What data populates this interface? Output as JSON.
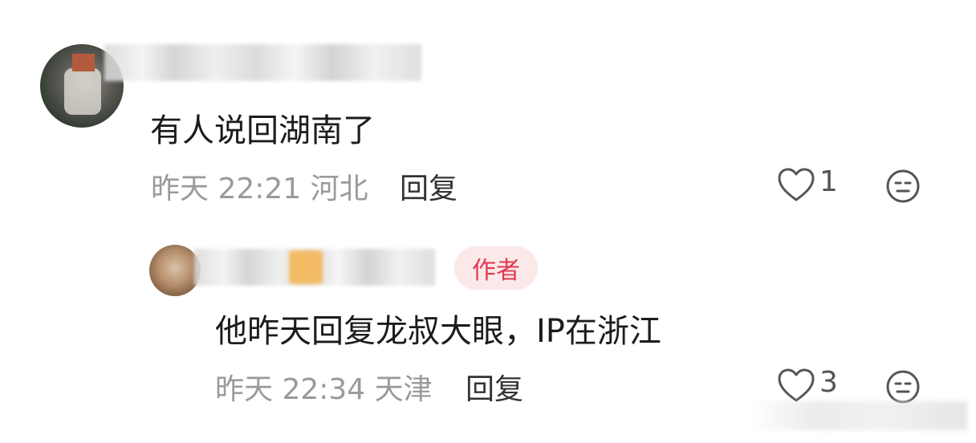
{
  "comments": [
    {
      "text": "有人说回湖南了",
      "time": "昨天 22:21",
      "location": "河北",
      "reply_label": "回复",
      "likes": "1"
    },
    {
      "badge": "作者",
      "text": "他昨天回复龙叔大眼，IP在浙江",
      "time": "昨天 22:34",
      "location": "天津",
      "reply_label": "回复",
      "likes": "3"
    }
  ],
  "icons": {
    "like": "heart-outline-icon",
    "emoji": "neutral-face-icon"
  },
  "colors": {
    "badge_text": "#e2394f",
    "badge_bg": "#fbe9ea",
    "meta": "#9a9a9a"
  }
}
